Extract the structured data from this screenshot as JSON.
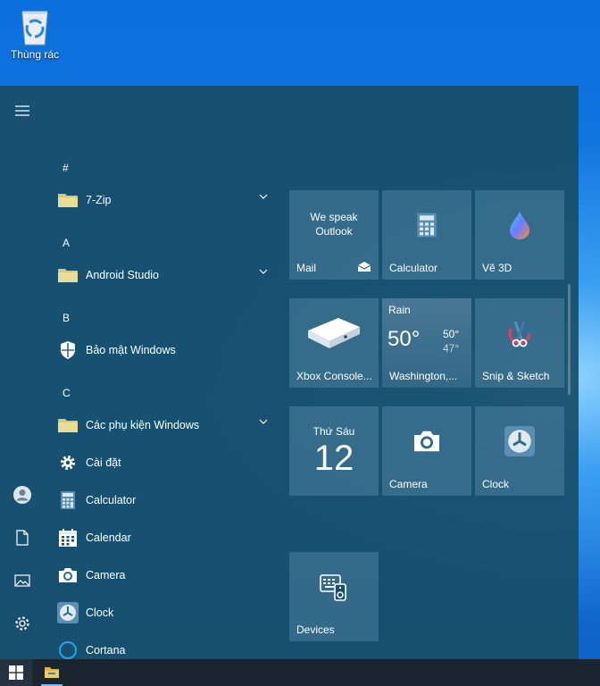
{
  "desktop": {
    "recycle_bin_label": "Thùng rác"
  },
  "rail": {
    "icons": [
      "hamburger-icon",
      "user-icon",
      "document-icon",
      "pictures-icon",
      "settings-icon"
    ]
  },
  "app_list": [
    {
      "type": "letter",
      "label": "#"
    },
    {
      "type": "app",
      "label": "7-Zip",
      "icon": "folder-icon",
      "expandable": true
    },
    {
      "type": "letter",
      "label": "A"
    },
    {
      "type": "app",
      "label": "Android Studio",
      "icon": "folder-icon",
      "expandable": true
    },
    {
      "type": "letter",
      "label": "B"
    },
    {
      "type": "app",
      "label": "Bảo mật Windows",
      "icon": "shield-icon",
      "expandable": false
    },
    {
      "type": "letter",
      "label": "C"
    },
    {
      "type": "app",
      "label": "Các phụ kiện Windows",
      "icon": "folder-icon",
      "expandable": true
    },
    {
      "type": "app",
      "label": "Cài đặt",
      "icon": "gear-icon",
      "expandable": false
    },
    {
      "type": "app",
      "label": "Calculator",
      "icon": "calculator-icon",
      "expandable": false
    },
    {
      "type": "app",
      "label": "Calendar",
      "icon": "calendar-icon",
      "expandable": false
    },
    {
      "type": "app",
      "label": "Camera",
      "icon": "camera-icon",
      "expandable": false
    },
    {
      "type": "app",
      "label": "Clock",
      "icon": "clock-icon",
      "expandable": false
    },
    {
      "type": "app",
      "label": "Cortana",
      "icon": "cortana-icon",
      "expandable": false
    }
  ],
  "tiles": {
    "mail": {
      "label": "Mail",
      "text": "We speak Outlook",
      "icon": "mail-icon"
    },
    "calculator": {
      "label": "Calculator",
      "icon": "calculator-icon"
    },
    "paint3d": {
      "label": "Vẽ 3D",
      "icon": "paint-drop-icon"
    },
    "xbox": {
      "label": "Xbox Console...",
      "icon": "xbox-console-icon"
    },
    "weather": {
      "condition": "Rain",
      "temp": "50°",
      "high": "50°",
      "low": "47°",
      "label": "Washington,..."
    },
    "snip": {
      "label": "Snip & Sketch",
      "icon": "scissors-icon"
    },
    "calendar": {
      "day_name": "Thứ Sáu",
      "day_number": "12"
    },
    "camera": {
      "label": "Camera",
      "icon": "camera-icon"
    },
    "clock": {
      "label": "Clock",
      "icon": "clock-icon"
    },
    "devices": {
      "label": "Devices",
      "icon": "devices-icon"
    }
  },
  "taskbar": {
    "items": [
      "windows-start-icon",
      "file-explorer-icon"
    ]
  },
  "colors": {
    "accent": "#76b9ed",
    "menu_bg": "#184e68",
    "taskbar": "#1b2530"
  }
}
